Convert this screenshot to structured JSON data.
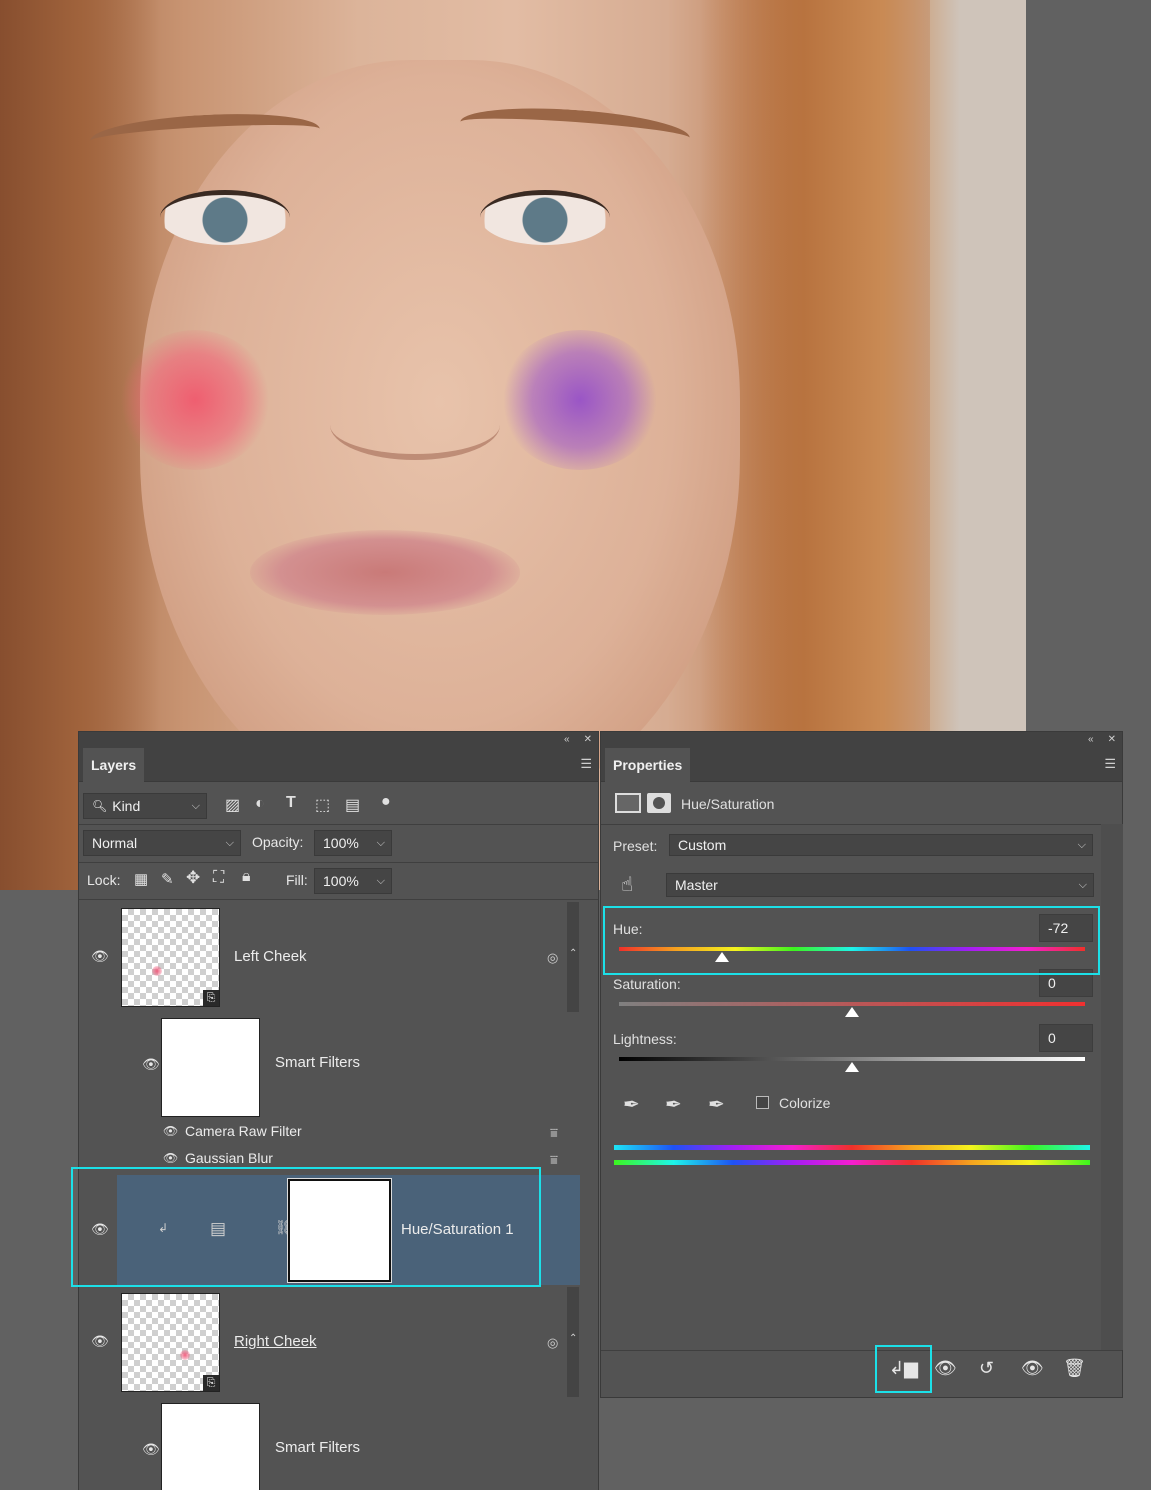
{
  "canvas": {
    "description_name": "portrait-canvas"
  },
  "layers_panel": {
    "tab_label": "Layers",
    "filter_label": "Kind",
    "blend_mode": "Normal",
    "opacity_label": "Opacity:",
    "opacity_value": "100%",
    "lock_label": "Lock:",
    "fill_label": "Fill:",
    "fill_value": "100%",
    "layers": [
      {
        "name": "Left Cheek"
      },
      {
        "name": "Smart Filters"
      },
      {
        "name": "Camera Raw Filter"
      },
      {
        "name": "Gaussian Blur"
      },
      {
        "name": "Hue/Saturation 1"
      },
      {
        "name": "Right Cheek"
      },
      {
        "name": "Smart Filters"
      }
    ]
  },
  "properties_panel": {
    "tab_label": "Properties",
    "header_title": "Hue/Saturation",
    "preset_label": "Preset:",
    "preset_value": "Custom",
    "channel_value": "Master",
    "hue_label": "Hue:",
    "hue_value": "-72",
    "saturation_label": "Saturation:",
    "saturation_value": "0",
    "lightness_label": "Lightness:",
    "lightness_value": "0",
    "colorize_label": "Colorize",
    "colorize_checked": false
  },
  "colors": {
    "highlight": "#1ce0e8",
    "selected_row": "#4a6279",
    "panel_bg": "#535353"
  }
}
